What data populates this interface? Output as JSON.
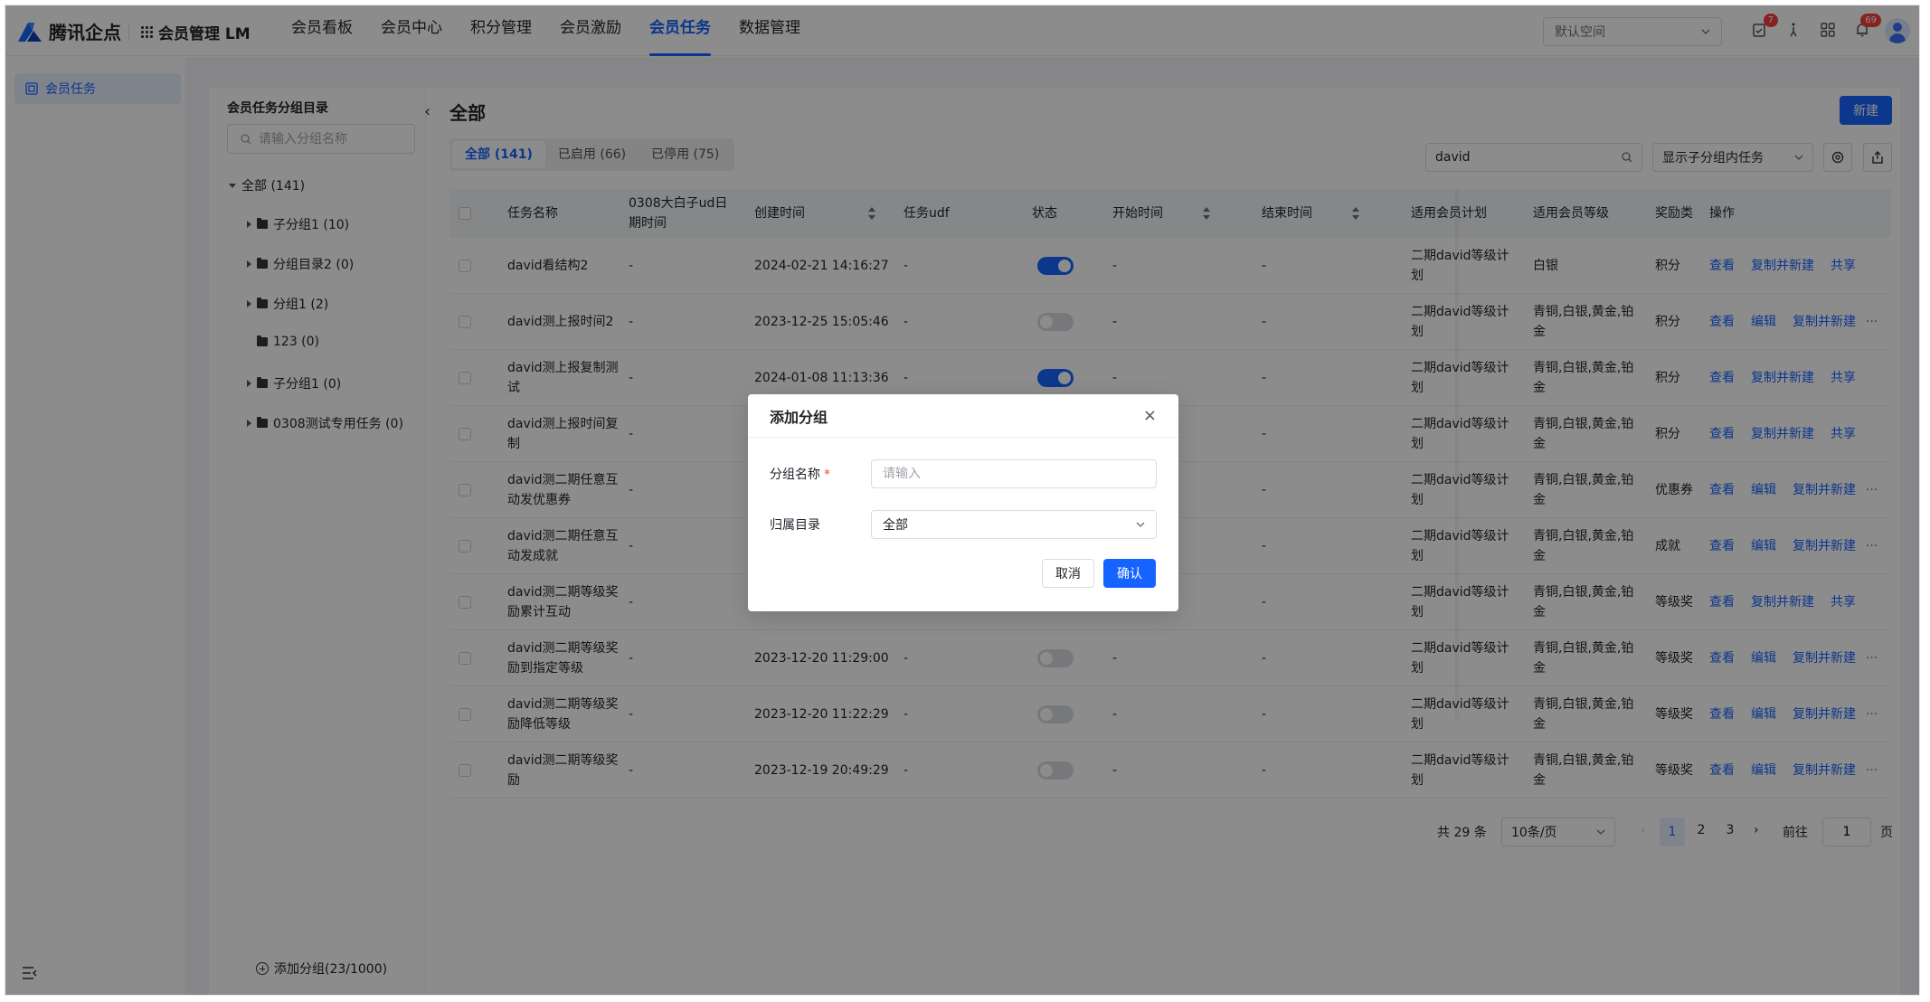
{
  "brand": {
    "logo_text": "腾讯企点",
    "app_name": "会员管理 LM"
  },
  "nav": {
    "items": [
      "会员看板",
      "会员中心",
      "积分管理",
      "会员激励",
      "会员任务",
      "数据管理"
    ],
    "active_index": 4
  },
  "header": {
    "space_select": "默认空间",
    "todo_badge": "7",
    "notice_badge": "69"
  },
  "left_nav": {
    "item": "会员任务"
  },
  "tree": {
    "title": "会员任务分组目录",
    "search_placeholder": "请输入分组名称",
    "root": "全部 (141)",
    "items": [
      {
        "label": "子分组1 (10)",
        "expandable": true
      },
      {
        "label": "分组目录2 (0)",
        "expandable": true
      },
      {
        "label": "分组1 (2)",
        "expandable": true
      },
      {
        "label": "123 (0)",
        "expandable": false
      },
      {
        "label": "子分组1 (0)",
        "expandable": true
      },
      {
        "label": "0308测试专用任务 (0)",
        "expandable": true
      }
    ],
    "add_group": "添加分组(23/1000)"
  },
  "main": {
    "title": "全部",
    "new_button": "新建",
    "tabs": [
      "全部 (141)",
      "已启用 (66)",
      "已停用 (75)"
    ],
    "search_value": "david",
    "child_select": "显示子分组内任务"
  },
  "table": {
    "headers": [
      "任务名称",
      "0308大白子ud日期时间",
      "创建时间",
      "任务udf",
      "状态",
      "开始时间",
      "结束时间",
      "适用会员计划",
      "适用会员等级",
      "奖励类",
      "操作"
    ],
    "rows": [
      {
        "name": "david看结构2",
        "udt": "-",
        "created": "2024-02-21 14:16:27",
        "udf": "-",
        "on": true,
        "start": "-",
        "end": "-",
        "plan": "二期david等级计划",
        "level": "白银",
        "reward": "积分",
        "actions": [
          "查看",
          "复制并新建",
          "共享"
        ],
        "more": false
      },
      {
        "name": "david测上报时间2",
        "udt": "-",
        "created": "2023-12-25 15:05:46",
        "udf": "-",
        "on": false,
        "start": "-",
        "end": "-",
        "plan": "二期david等级计划",
        "level": "青铜,白银,黄金,铂金",
        "reward": "积分",
        "actions": [
          "查看",
          "编辑",
          "复制并新建"
        ],
        "more": true
      },
      {
        "name": "david测上报复制测试",
        "udt": "-",
        "created": "2024-01-08 11:13:36",
        "udf": "-",
        "on": true,
        "start": "-",
        "end": "-",
        "plan": "二期david等级计划",
        "level": "青铜,白银,黄金,铂金",
        "reward": "积分",
        "actions": [
          "查看",
          "复制并新建",
          "共享"
        ],
        "more": false
      },
      {
        "name": "david测上报时间复制",
        "udt": "-",
        "created": "",
        "udf": "",
        "on": null,
        "start": "",
        "end": "-",
        "plan": "二期david等级计划",
        "level": "青铜,白银,黄金,铂金",
        "reward": "积分",
        "actions": [
          "查看",
          "复制并新建",
          "共享"
        ],
        "more": false
      },
      {
        "name": "david测二期任意互动发优惠券",
        "udt": "-",
        "created": "",
        "udf": "",
        "on": null,
        "start": "",
        "end": "-",
        "plan": "二期david等级计划",
        "level": "青铜,白银,黄金,铂金",
        "reward": "优惠券",
        "actions": [
          "查看",
          "编辑",
          "复制并新建"
        ],
        "more": true
      },
      {
        "name": "david测二期任意互动发成就",
        "udt": "-",
        "created": "",
        "udf": "",
        "on": null,
        "start": "",
        "end": "-",
        "plan": "二期david等级计划",
        "level": "青铜,白银,黄金,铂金",
        "reward": "成就",
        "actions": [
          "查看",
          "编辑",
          "复制并新建"
        ],
        "more": true
      },
      {
        "name": "david测二期等级奖励累计互动",
        "udt": "-",
        "created": "",
        "udf": "",
        "on": null,
        "start": "",
        "end": "-",
        "plan": "二期david等级计划",
        "level": "青铜,白银,黄金,铂金",
        "reward": "等级奖",
        "actions": [
          "查看",
          "复制并新建",
          "共享"
        ],
        "more": false
      },
      {
        "name": "david测二期等级奖励到指定等级",
        "udt": "-",
        "created": "2023-12-20 11:29:00",
        "udf": "-",
        "on": false,
        "start": "-",
        "end": "-",
        "plan": "二期david等级计划",
        "level": "青铜,白银,黄金,铂金",
        "reward": "等级奖",
        "actions": [
          "查看",
          "编辑",
          "复制并新建"
        ],
        "more": true
      },
      {
        "name": "david测二期等级奖励降低等级",
        "udt": "-",
        "created": "2023-12-20 11:22:29",
        "udf": "-",
        "on": false,
        "start": "-",
        "end": "-",
        "plan": "二期david等级计划",
        "level": "青铜,白银,黄金,铂金",
        "reward": "等级奖",
        "actions": [
          "查看",
          "编辑",
          "复制并新建"
        ],
        "more": true
      },
      {
        "name": "david测二期等级奖励",
        "udt": "-",
        "created": "2023-12-19 20:49:29",
        "udf": "-",
        "on": false,
        "start": "-",
        "end": "-",
        "plan": "二期david等级计划",
        "level": "青铜,白银,黄金,铂金",
        "reward": "等级奖",
        "actions": [
          "查看",
          "编辑",
          "复制并新建"
        ],
        "more": true
      }
    ]
  },
  "pagination": {
    "total": "共 29 条",
    "page_size": "10条/页",
    "pages": [
      "1",
      "2",
      "3"
    ],
    "current": "1",
    "goto_label": "前往",
    "goto_value": "1",
    "page_unit": "页"
  },
  "modal": {
    "title": "添加分组",
    "name_label": "分组名称",
    "name_placeholder": "请输入",
    "dir_label": "归属目录",
    "dir_value": "全部",
    "cancel": "取消",
    "confirm": "确认"
  },
  "colors": {
    "primary": "#1664ff",
    "danger": "#f53f3f",
    "overlay": "rgba(0,0,0,0.45)"
  }
}
